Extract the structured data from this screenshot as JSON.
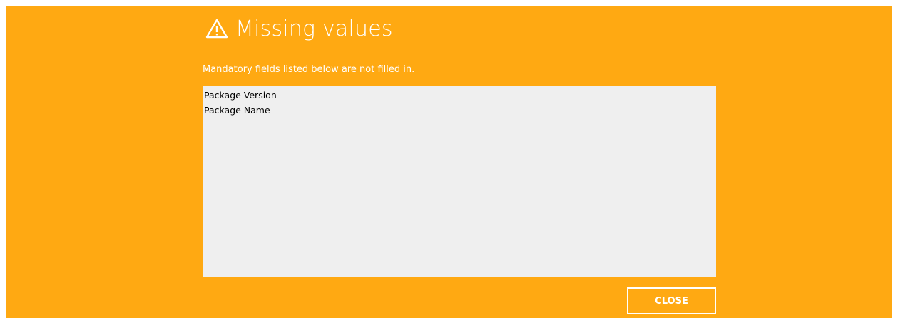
{
  "dialog": {
    "title": "Missing values",
    "icon": "warning-icon",
    "message": "Mandatory fields listed below are not filled in.",
    "missing_fields": [
      "Package Version",
      "Package Name"
    ],
    "close_label": "CLOSE"
  },
  "colors": {
    "background": "#FFA912",
    "list_background": "#EFEFEF",
    "text": "#FFFFFF"
  }
}
